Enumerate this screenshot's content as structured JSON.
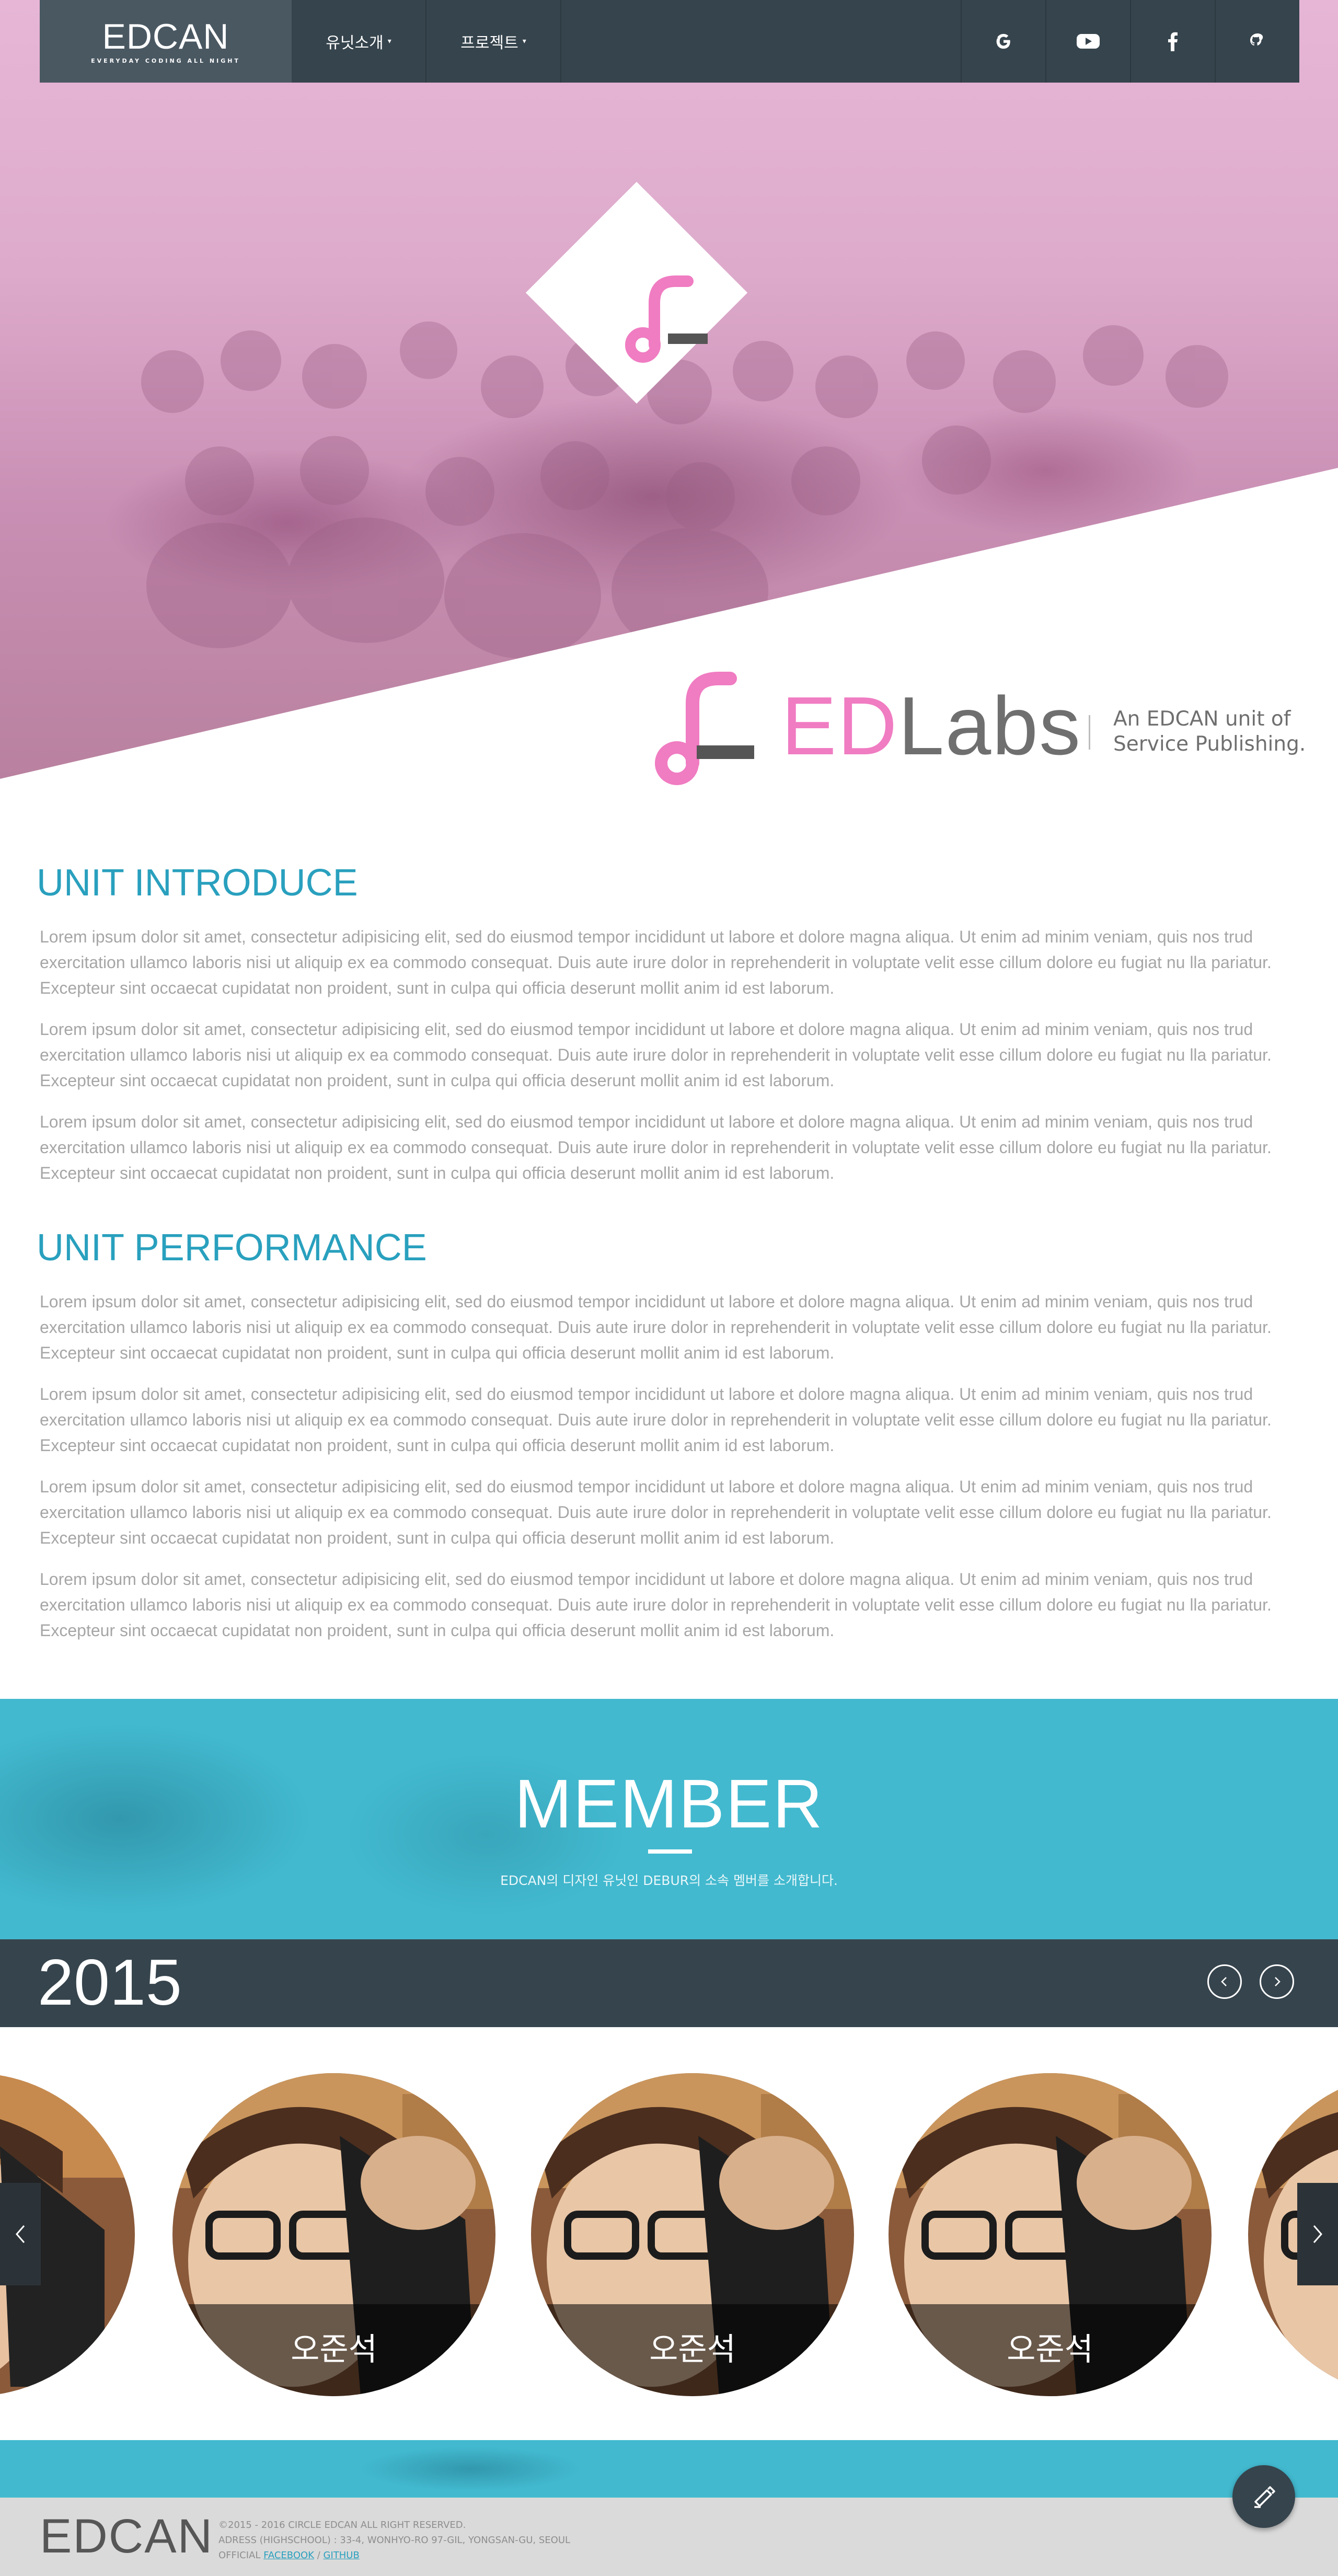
{
  "nav": {
    "logo": "EDCAN",
    "logo_sub": "EVERYDAY CODING ALL NIGHT",
    "items": [
      {
        "label": "유닛소개"
      },
      {
        "label": "프로젝트"
      }
    ],
    "social": [
      "google-icon",
      "youtube-icon",
      "facebook-icon",
      "github-icon"
    ]
  },
  "brand": {
    "ed": "ED",
    "labs": "Labs",
    "tagline_1": "An EDCAN unit of",
    "tagline_2": "Service Publishing.",
    "accent_color": "#f07cc2"
  },
  "intro": {
    "title": "UNIT INTRODUCE",
    "paragraphs": [
      "Lorem ipsum dolor sit amet, consectetur adipisicing elit, sed do eiusmod tempor incididunt ut labore et dolore magna aliqua. Ut enim ad minim veniam, quis nos trud exercitation ullamco laboris nisi ut aliquip ex ea commodo consequat. Duis aute irure dolor in reprehenderit in voluptate velit esse cillum dolore eu fugiat nu lla pariatur. Excepteur sint occaecat cupidatat non proident, sunt in culpa qui officia deserunt mollit anim id est laborum.",
      "Lorem ipsum dolor sit amet, consectetur adipisicing elit, sed do eiusmod tempor incididunt ut labore et dolore magna aliqua. Ut enim ad minim veniam, quis nos trud exercitation ullamco laboris nisi ut aliquip ex ea commodo consequat. Duis aute irure dolor in reprehenderit in voluptate velit esse cillum dolore eu fugiat nu lla pariatur. Excepteur sint occaecat cupidatat non proident, sunt in culpa qui officia deserunt mollit anim id est laborum.",
      "Lorem ipsum dolor sit amet, consectetur adipisicing elit, sed do eiusmod tempor incididunt ut labore et dolore magna aliqua. Ut enim ad minim veniam, quis nos trud exercitation ullamco laboris nisi ut aliquip ex ea commodo consequat. Duis aute irure dolor in reprehenderit in voluptate velit esse cillum dolore eu fugiat nu lla pariatur. Excepteur sint occaecat cupidatat non proident, sunt in culpa qui officia deserunt mollit anim id est laborum."
    ]
  },
  "performance": {
    "title": "UNIT PERFORMANCE",
    "paragraphs": [
      "Lorem ipsum dolor sit amet, consectetur adipisicing elit, sed do eiusmod tempor incididunt ut labore et dolore magna aliqua. Ut enim ad minim veniam, quis nos trud exercitation ullamco laboris nisi ut aliquip ex ea commodo consequat. Duis aute irure dolor in reprehenderit in voluptate velit esse cillum dolore eu fugiat nu lla pariatur. Excepteur sint occaecat cupidatat non proident, sunt in culpa qui officia deserunt mollit anim id est laborum.",
      "Lorem ipsum dolor sit amet, consectetur adipisicing elit, sed do eiusmod tempor incididunt ut labore et dolore magna aliqua. Ut enim ad minim veniam, quis nos trud exercitation ullamco laboris nisi ut aliquip ex ea commodo consequat. Duis aute irure dolor in reprehenderit in voluptate velit esse cillum dolore eu fugiat nu lla pariatur. Excepteur sint occaecat cupidatat non proident, sunt in culpa qui officia deserunt mollit anim id est laborum.",
      "Lorem ipsum dolor sit amet, consectetur adipisicing elit, sed do eiusmod tempor incididunt ut labore et dolore magna aliqua. Ut enim ad minim veniam, quis nos trud exercitation ullamco laboris nisi ut aliquip ex ea commodo consequat. Duis aute irure dolor in reprehenderit in voluptate velit esse cillum dolore eu fugiat nu lla pariatur. Excepteur sint occaecat cupidatat non proident, sunt in culpa qui officia deserunt mollit anim id est laborum.",
      "Lorem ipsum dolor sit amet, consectetur adipisicing elit, sed do eiusmod tempor incididunt ut labore et dolore magna aliqua. Ut enim ad minim veniam, quis nos trud exercitation ullamco laboris nisi ut aliquip ex ea commodo consequat. Duis aute irure dolor in reprehenderit in voluptate velit esse cillum dolore eu fugiat nu lla pariatur. Excepteur sint occaecat cupidatat non proident, sunt in culpa qui officia deserunt mollit anim id est laborum."
    ]
  },
  "member": {
    "title": "MEMBER",
    "subtitle": "EDCAN의 디자인 유닛인 DEBUR의 소속 멤버를 소개합니다.",
    "year": "2015",
    "cards": [
      {
        "name": "오준석"
      },
      {
        "name": "오준석"
      },
      {
        "name": "오준석"
      }
    ],
    "accent_color": "#42b9cf"
  },
  "footer": {
    "logo": "EDCAN",
    "copyright": "©2015 - 2016 CIRCLE EDCAN ALL RIGHT RESERVED.",
    "address": "ADRESS (HIGHSCHOOL) : 33-4, WONHYO-RO 97-GIL, YONGSAN-GU, SEOUL",
    "official_label": "OFFICIAL",
    "facebook": "FACEBOOK",
    "separator": "/",
    "github": "GITHUB"
  }
}
